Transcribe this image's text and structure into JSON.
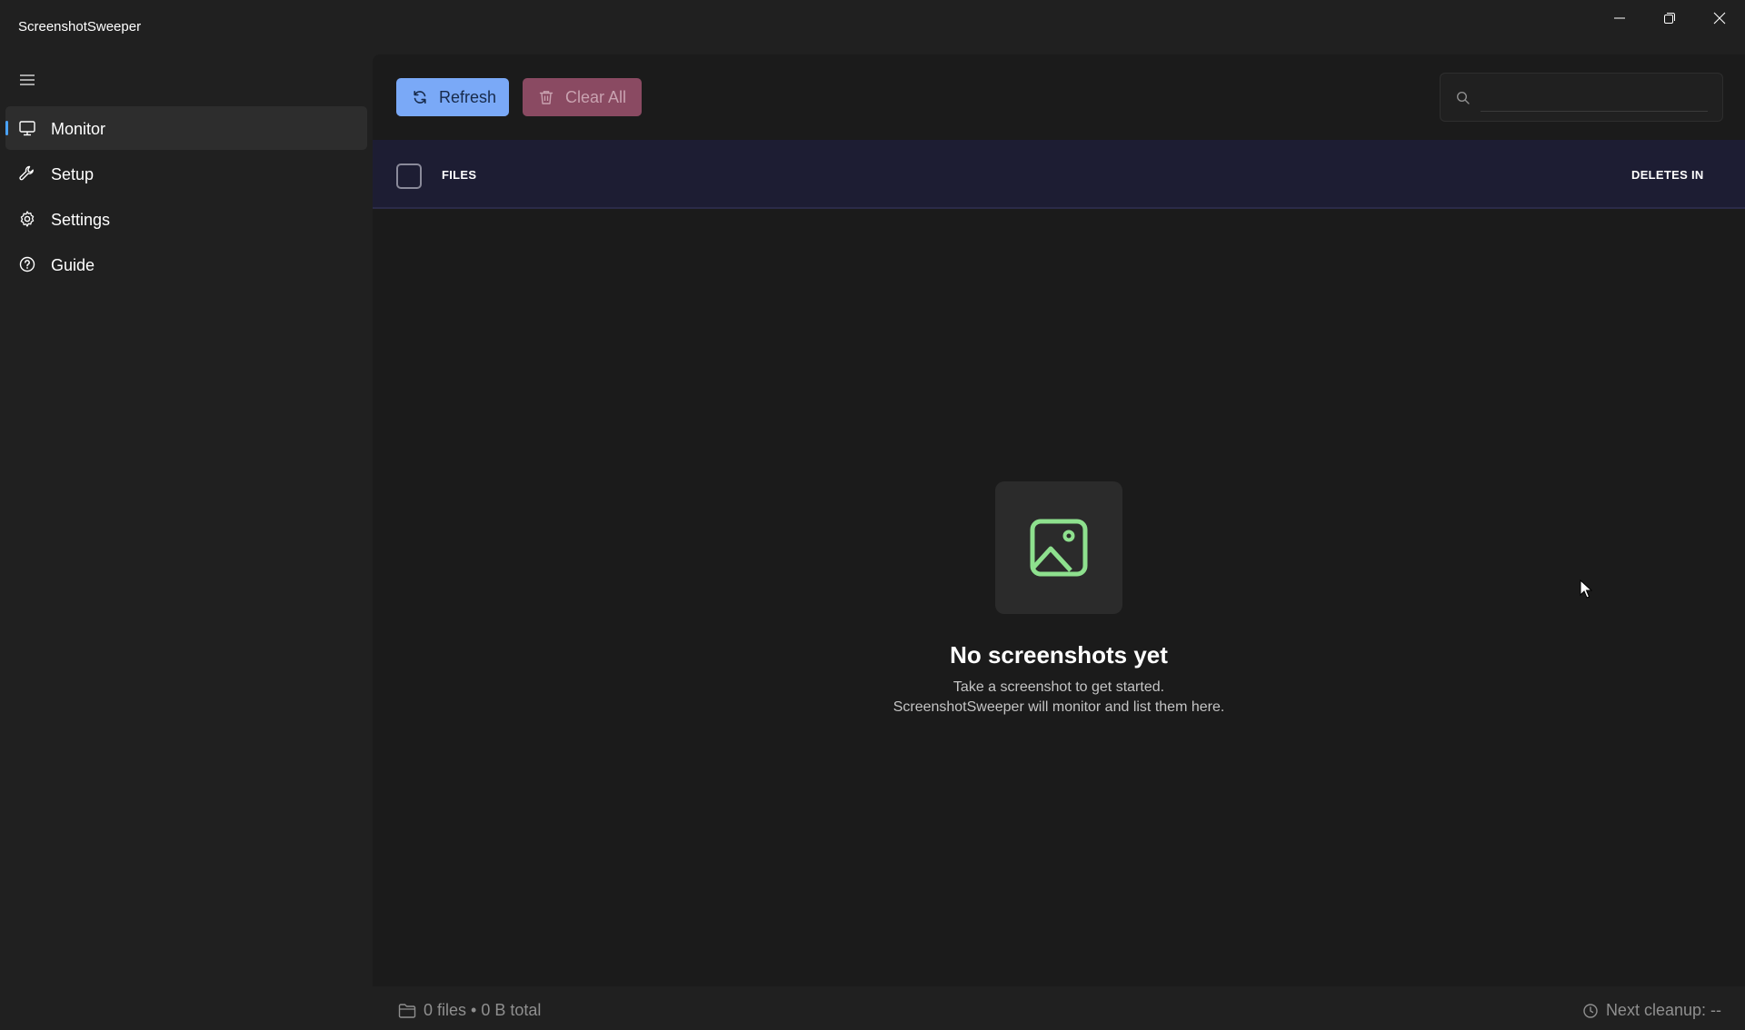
{
  "window": {
    "title": "ScreenshotSweeper"
  },
  "sidebar": {
    "items": [
      {
        "label": "Monitor",
        "icon": "monitor-icon",
        "active": true
      },
      {
        "label": "Setup",
        "icon": "wrench-icon"
      },
      {
        "label": "Settings",
        "icon": "gear-icon"
      },
      {
        "label": "Guide",
        "icon": "help-circle-icon"
      }
    ]
  },
  "toolbar": {
    "refresh_label": "Refresh",
    "clear_all_label": "Clear All"
  },
  "search": {
    "placeholder": "",
    "value": ""
  },
  "table": {
    "columns": [
      "FILES",
      "DELETES IN"
    ]
  },
  "empty_state": {
    "icon": "image-icon",
    "title": "No screenshots yet",
    "line1": "Take a screenshot to get started.",
    "line2": "ScreenshotSweeper will monitor and list them here."
  },
  "status": {
    "summary": "0 files • 0 B total",
    "next_cleanup": "Next cleanup: --"
  },
  "colors": {
    "accent": "#4aa3ff",
    "refresh_button": "#7aa9f7",
    "clear_button": "#8a4a62",
    "empty_icon": "#8ee08e",
    "header_bg": "#1d1d33"
  }
}
